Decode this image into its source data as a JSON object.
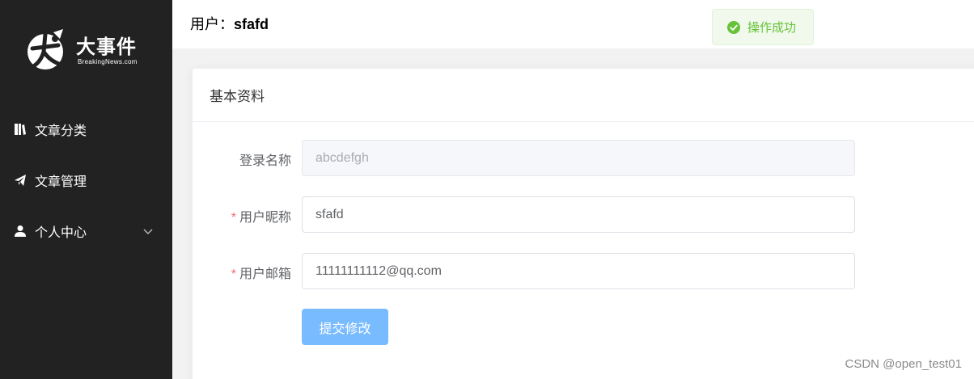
{
  "sidebar": {
    "logo": {
      "title": "大事件",
      "subtitle": "BreakingNews.com"
    },
    "items": [
      {
        "label": "文章分类",
        "icon": "book-icon"
      },
      {
        "label": "文章管理",
        "icon": "paper-plane-icon"
      },
      {
        "label": "个人中心",
        "icon": "user-icon",
        "expandable": true
      }
    ]
  },
  "header": {
    "user_prefix": "用户：",
    "username": "sfafd"
  },
  "toast": {
    "message": "操作成功",
    "icon": "success-check-icon",
    "color": "#67c23a"
  },
  "card": {
    "title": "基本资料",
    "fields": [
      {
        "label": "登录名称",
        "value": "abcdefgh",
        "required": false,
        "disabled": true
      },
      {
        "label": "用户昵称",
        "value": "sfafd",
        "required": true,
        "disabled": false
      },
      {
        "label": "用户邮箱",
        "value": "11111111112@qq.com",
        "required": true,
        "disabled": false
      }
    ],
    "required_mark": "*",
    "submit_label": "提交修改"
  },
  "watermark": "CSDN @open_test01",
  "colors": {
    "sidebar_bg": "#222222",
    "primary_light": "#79bbff",
    "required": "#f56c6c"
  }
}
